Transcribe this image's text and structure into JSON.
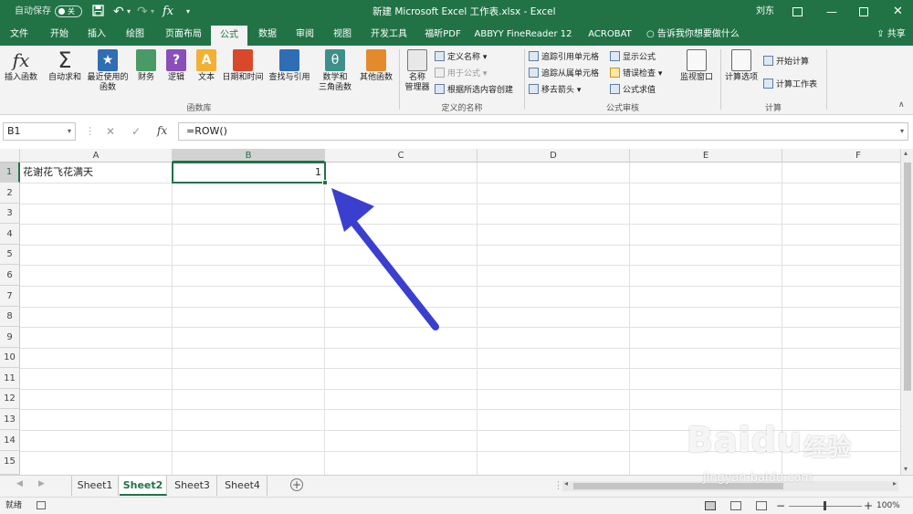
{
  "titlebar": {
    "autosave_label": "自动保存",
    "autosave_state": "关",
    "window_title": "新建 Microsoft Excel 工作表.xlsx  -  Excel",
    "user": "刘东"
  },
  "tabs": [
    "文件",
    "开始",
    "插入",
    "绘图",
    "页面布局",
    "公式",
    "数据",
    "审阅",
    "视图",
    "开发工具",
    "福昕PDF",
    "ABBYY FineReader 12",
    "ACROBAT"
  ],
  "active_tab": "公式",
  "tell_me": "告诉我你想要做什么",
  "share": "共享",
  "ribbon": {
    "function_library": {
      "group_label": "函数库",
      "insert_function": "插入函数",
      "autosum": "自动求和",
      "recent_line1": "最近使用的",
      "recent_line2": "函数",
      "financial": "财务",
      "logical": "逻辑",
      "text": "文本",
      "datetime": "日期和时间",
      "lookup": "查找与引用",
      "math_line1": "数学和",
      "math_line2": "三角函数",
      "more": "其他函数"
    },
    "defined_names": {
      "group_label": "定义的名称",
      "name_manager_line1": "名称",
      "name_manager_line2": "管理器",
      "define_name": "定义名称",
      "use_in_formula": "用于公式",
      "create_from_selection": "根据所选内容创建"
    },
    "formula_auditing": {
      "group_label": "公式审核",
      "trace_precedents": "追踪引用单元格",
      "trace_dependents": "追踪从属单元格",
      "remove_arrows": "移去箭头",
      "show_formulas": "显示公式",
      "error_checking": "错误检查",
      "evaluate_formula": "公式求值",
      "watch_window": "监视窗口"
    },
    "calculation": {
      "group_label": "计算",
      "calc_options": "计算选项",
      "calc_now": "开始计算",
      "calc_sheet": "计算工作表"
    }
  },
  "formula_bar": {
    "name_box": "B1",
    "formula": "=ROW()"
  },
  "columns": [
    "A",
    "B",
    "C",
    "D",
    "E",
    "F"
  ],
  "selected_column": "B",
  "rows": [
    "1",
    "2",
    "3",
    "4",
    "5",
    "6",
    "7",
    "8",
    "9",
    "10",
    "11",
    "12",
    "13",
    "14",
    "15"
  ],
  "cells": {
    "A1": "花谢花飞花满天",
    "B1": "1"
  },
  "sheets": [
    "Sheet1",
    "Sheet2",
    "Sheet3",
    "Sheet4"
  ],
  "active_sheet": "Sheet2",
  "status": {
    "ready": "就绪",
    "zoom": "100%"
  },
  "watermark": {
    "brand": "Baidu",
    "brand_cn": "经验",
    "url": "jingyan.baidu.com"
  },
  "colors": {
    "excel_green": "#217346",
    "arrow": "#3b3fcf"
  }
}
